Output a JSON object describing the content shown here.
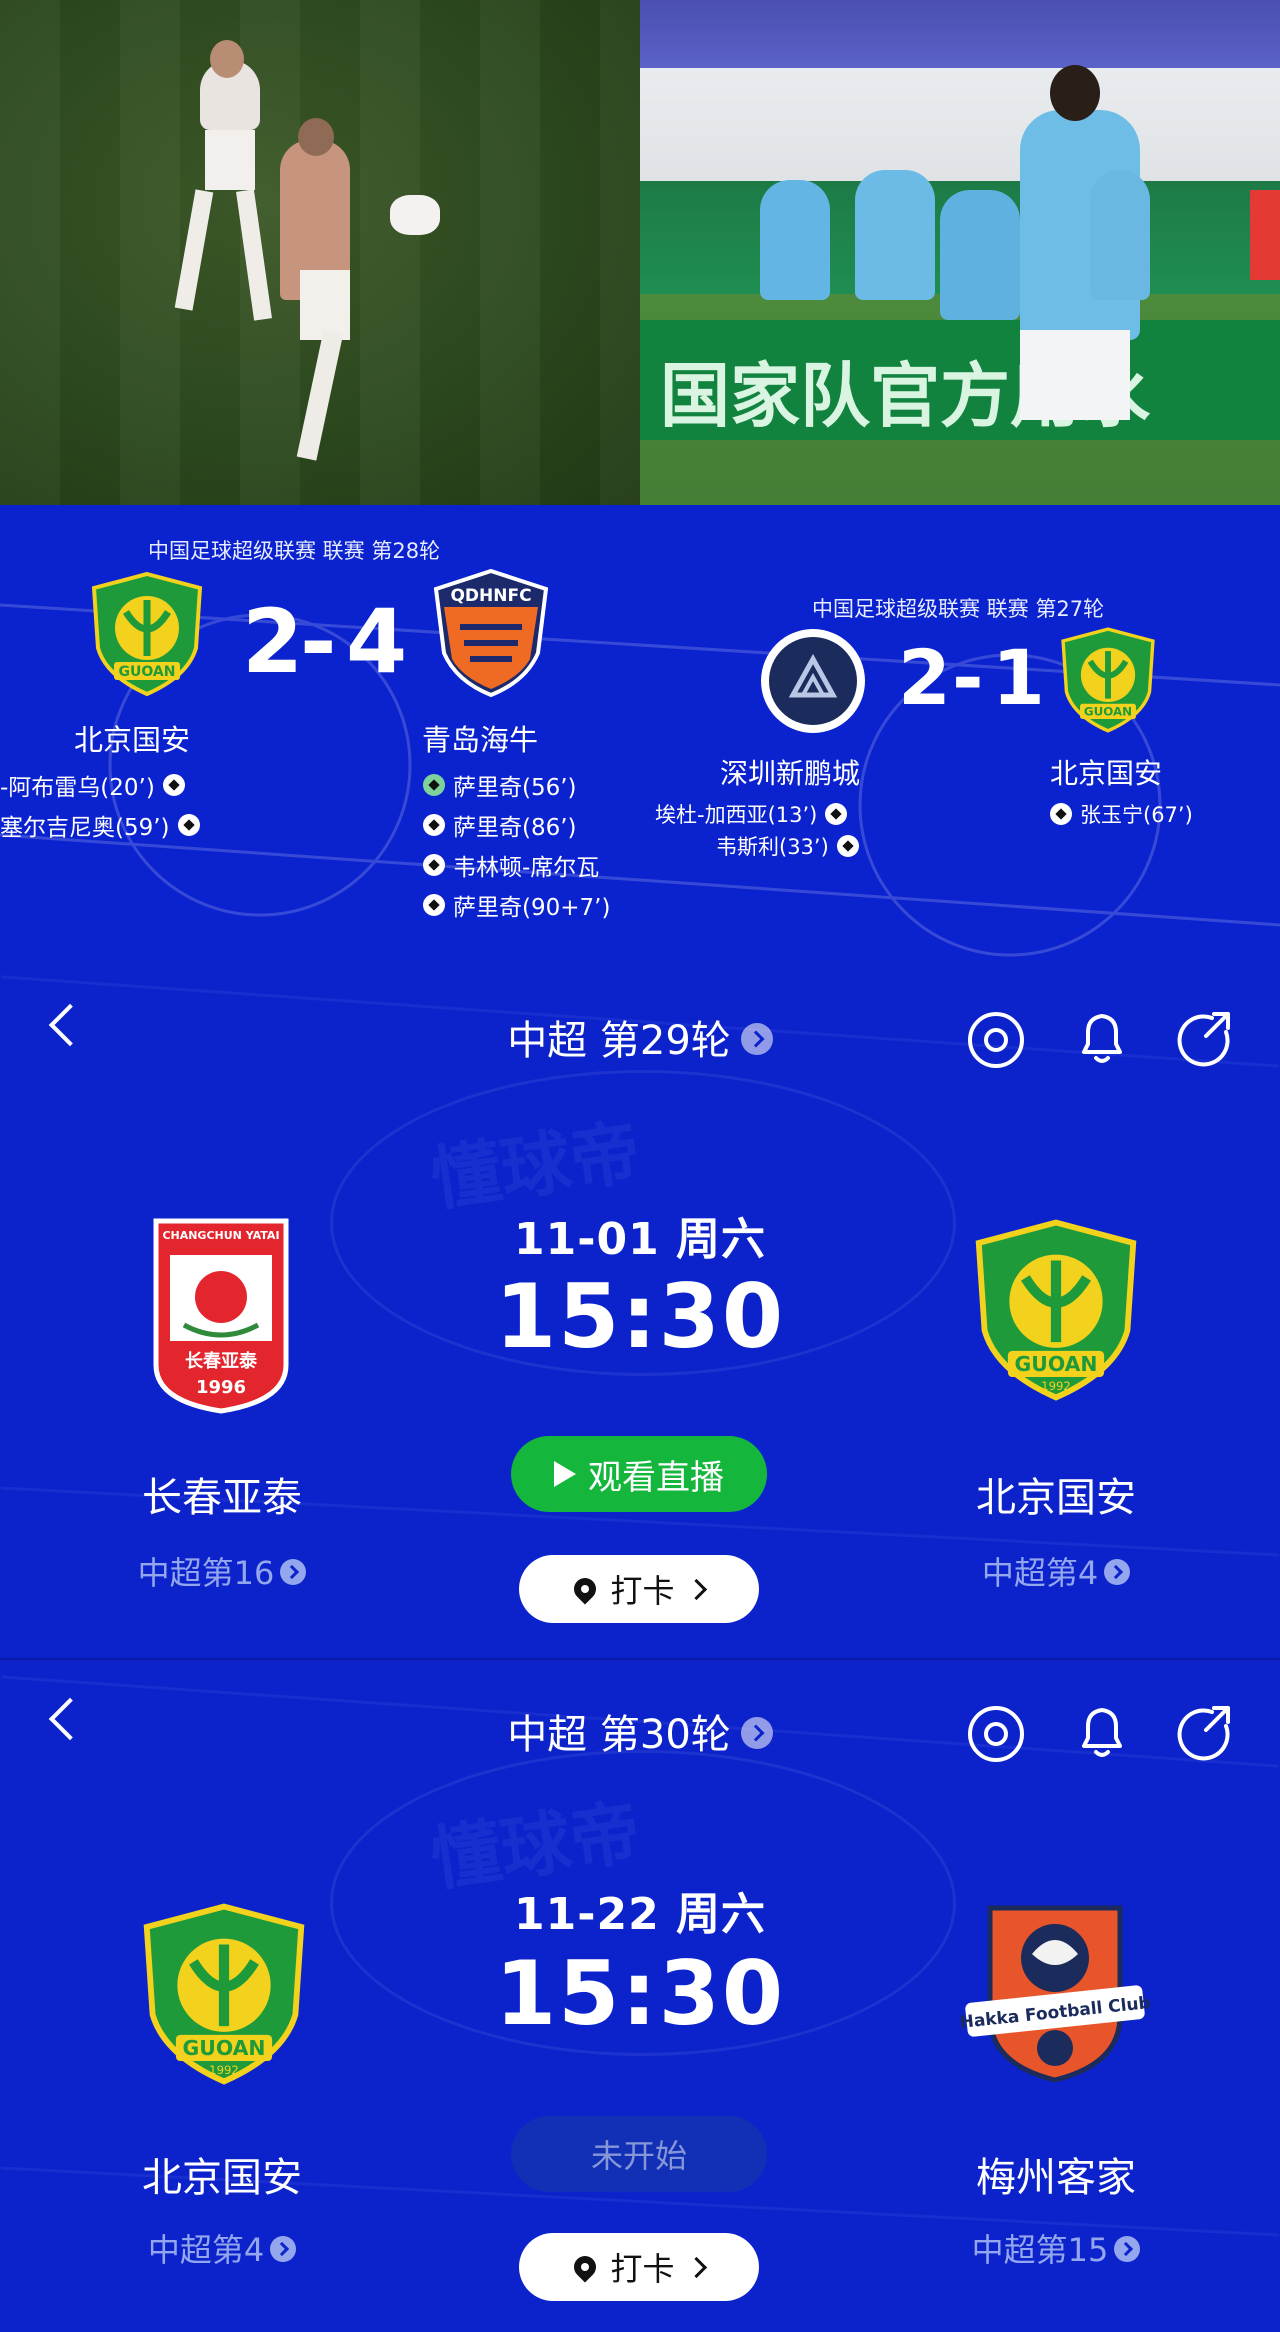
{
  "results": [
    {
      "league_line": "中国足球超级联赛 联赛 第28轮",
      "home_score": "2",
      "away_score": "4",
      "home_team": "北京国安",
      "away_team": "青岛海牛",
      "home_scorers": [
        "-阿布雷乌(20’)",
        "塞尔吉尼奥(59’)"
      ],
      "away_scorers": [
        "萨里奇(56’)",
        "萨里奇(86’)",
        "韦林顿-席尔瓦",
        "萨里奇(90+7’)"
      ]
    },
    {
      "league_line": "中国足球超级联赛 联赛 第27轮",
      "home_score": "2",
      "away_score": "1",
      "home_team": "深圳新鹏城",
      "away_team": "北京国安",
      "home_scorers": [
        "埃杜-加西亚(13’)",
        "韦斯利(33’)"
      ],
      "away_scorers": [
        "张玉宁(67’)"
      ]
    }
  ],
  "match1": {
    "round_title": "中超 第29轮",
    "date": "11-01 周六",
    "time": "15:30",
    "home_team": "长春亚泰",
    "home_rank": "中超第16",
    "away_team": "北京国安",
    "away_rank": "中超第4",
    "action_label": "观看直播",
    "checkin_label": "打卡",
    "home_badge_text_top": "CHANGCHUN YATAI",
    "home_badge_text_cn": "长春亚泰",
    "home_badge_year": "1996",
    "away_badge_text": "GUOAN",
    "away_badge_year": "1992"
  },
  "match2": {
    "round_title": "中超 第30轮",
    "date": "11-22 周六",
    "time": "15:30",
    "home_team": "北京国安",
    "home_rank": "中超第4",
    "away_team": "梅州客家",
    "away_rank": "中超第15",
    "status_label": "未开始",
    "checkin_label": "打卡",
    "home_badge_text": "GUOAN",
    "home_badge_year": "1992",
    "away_badge_text": "Hakka Football Club"
  },
  "colors": {
    "panel_blue": "#0b22cf",
    "guoan_green": "#1f9a3a",
    "guoan_yellow": "#f2d21c",
    "live_green": "#14b63c"
  }
}
